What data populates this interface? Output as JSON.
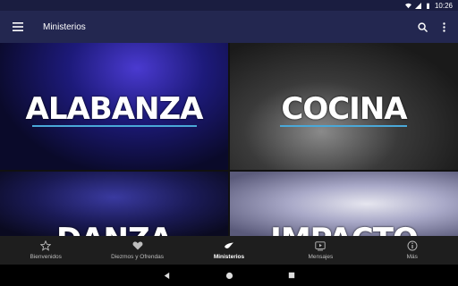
{
  "status_bar": {
    "time": "10:26"
  },
  "app_bar": {
    "title": "Ministerios"
  },
  "tiles": [
    {
      "label": "ALABANZA"
    },
    {
      "label": "COCINA"
    },
    {
      "label": "DANZA KHOOL"
    },
    {
      "label": "IMPACTO KIDS"
    }
  ],
  "bottom_nav": {
    "items": [
      {
        "label": "Bienvenidos",
        "icon": "star-icon"
      },
      {
        "label": "Diezmos y Ofrendas",
        "icon": "heart-icon"
      },
      {
        "label": "Ministerios",
        "icon": "dove-icon",
        "active": true
      },
      {
        "label": "Mensajes",
        "icon": "play-icon"
      },
      {
        "label": "Más",
        "icon": "info-icon"
      }
    ]
  },
  "colors": {
    "app_bar": "#232750",
    "status_bar": "#1a1d40",
    "accent_underline": "#4aa8d8"
  }
}
